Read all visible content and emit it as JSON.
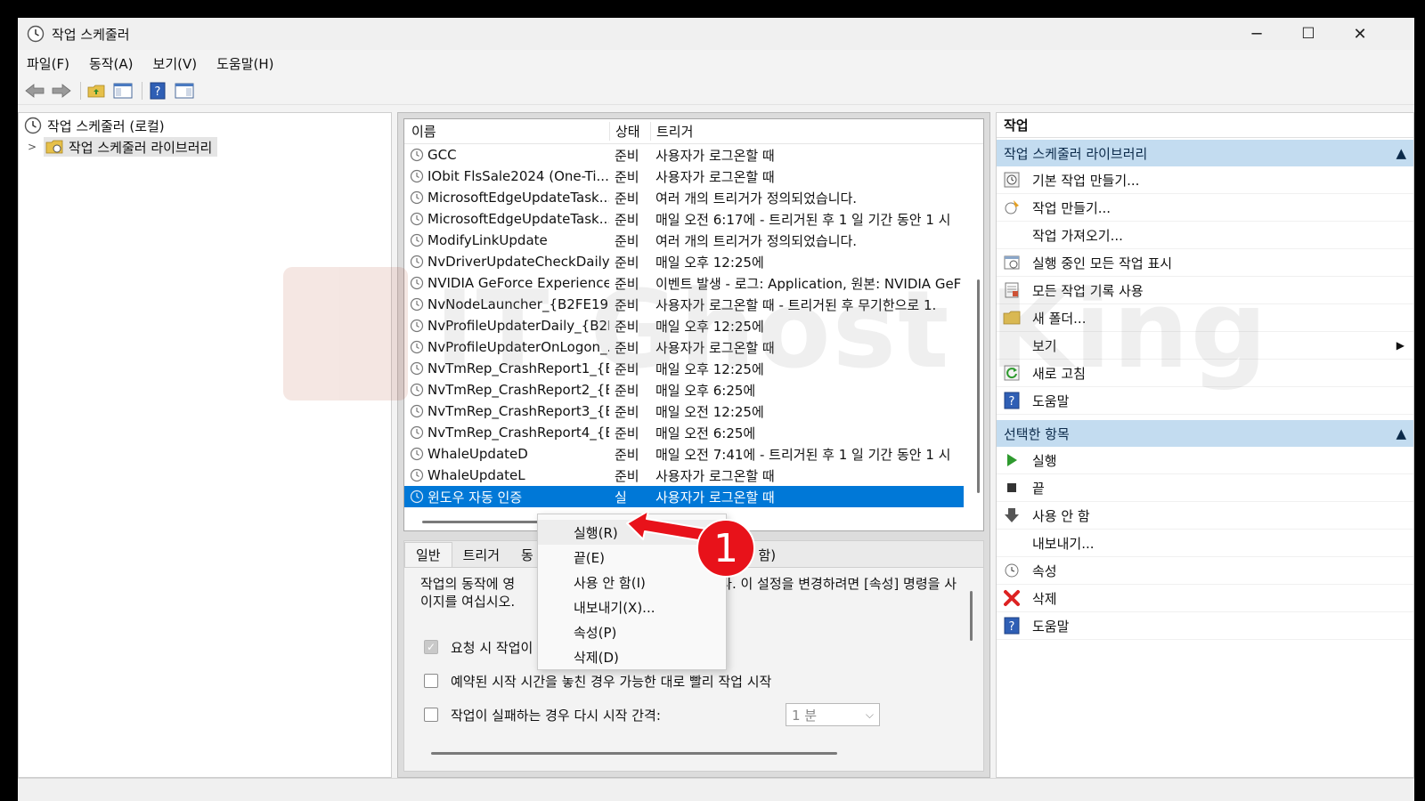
{
  "window": {
    "title": "작업 스케줄러",
    "min": "─",
    "max": "☐",
    "close": "✕"
  },
  "menu": [
    "파일(F)",
    "동작(A)",
    "보기(V)",
    "도움말(H)"
  ],
  "tree": {
    "root": "작업 스케줄러 (로컬)",
    "library": "작업 스케줄러 라이브러리"
  },
  "list": {
    "headers": {
      "name": "이름",
      "state": "상태",
      "trigger": "트리거"
    },
    "rows": [
      {
        "name": "GCC",
        "state": "준비",
        "trigger": "사용자가 로그온할 때"
      },
      {
        "name": "IObit FlsSale2024 (One-Ti...",
        "state": "준비",
        "trigger": "사용자가 로그온할 때"
      },
      {
        "name": "MicrosoftEdgeUpdateTask...",
        "state": "준비",
        "trigger": "여러 개의 트리거가 정의되었습니다."
      },
      {
        "name": "MicrosoftEdgeUpdateTask...",
        "state": "준비",
        "trigger": "매일 오전 6:17에 - 트리거된 후 1 일 기간 동안 1 시"
      },
      {
        "name": "ModifyLinkUpdate",
        "state": "준비",
        "trigger": "여러 개의 트리거가 정의되었습니다."
      },
      {
        "name": "NvDriverUpdateCheckDaily...",
        "state": "준비",
        "trigger": "매일 오후 12:25에"
      },
      {
        "name": "NVIDIA GeForce Experience...",
        "state": "준비",
        "trigger": "이벤트 발생 - 로그: Application, 원본: NVIDIA GeF"
      },
      {
        "name": "NvNodeLauncher_{B2FE19...",
        "state": "준비",
        "trigger": "사용자가 로그온할 때 - 트리거된 후 무기한으로 1."
      },
      {
        "name": "NvProfileUpdaterDaily_{B2F...",
        "state": "준비",
        "trigger": "매일 오후 12:25에"
      },
      {
        "name": "NvProfileUpdaterOnLogon_...",
        "state": "준비",
        "trigger": "사용자가 로그온할 때"
      },
      {
        "name": "NvTmRep_CrashReport1_{B...",
        "state": "준비",
        "trigger": "매일 오후 12:25에"
      },
      {
        "name": "NvTmRep_CrashReport2_{B...",
        "state": "준비",
        "trigger": "매일 오후 6:25에"
      },
      {
        "name": "NvTmRep_CrashReport3_{B...",
        "state": "준비",
        "trigger": "매일 오전 12:25에"
      },
      {
        "name": "NvTmRep_CrashReport4_{B...",
        "state": "준비",
        "trigger": "매일 오전 6:25에"
      },
      {
        "name": "WhaleUpdateD",
        "state": "준비",
        "trigger": "매일 오전 7:41에 - 트리거된 후 1 일 기간 동안 1 시"
      },
      {
        "name": "WhaleUpdateL",
        "state": "준비",
        "trigger": "사용자가 로그온할 때"
      },
      {
        "name": "윈도우 자동 인증",
        "state": "실",
        "trigger": "사용자가 로그온할 때"
      }
    ]
  },
  "detail": {
    "tabs": [
      "일반",
      "트리거",
      "동",
      "안 함)"
    ],
    "text_line1a": "작업의 동작에 영",
    "text_line1b": "다. 이 설정을 변경하려면 [속성] 명령을 사",
    "text_line2": "이지를 여십시오.",
    "chk1": "요청 시 작업이",
    "chk2": "예약된 시작 시간을 놓친 경우 가능한 대로 빨리 작업 시작",
    "chk3": "작업이 실패하는 경우 다시 시작 간격:",
    "combo_value": "1 분"
  },
  "context_menu": [
    "실행(R)",
    "끝(E)",
    "사용 안 함(I)",
    "내보내기(X)...",
    "속성(P)",
    "삭제(D)"
  ],
  "actions": {
    "header": "작업",
    "section1": "작업 스케줄러 라이브러리",
    "section1_items": [
      "기본 작업 만들기...",
      "작업 만들기...",
      "작업 가져오기...",
      "실행 중인 모든 작업 표시",
      "모든 작업 기록 사용",
      "새 폴더...",
      "보기",
      "새로 고침",
      "도움말"
    ],
    "section2": "선택한 항목",
    "section2_items": [
      "실행",
      "끝",
      "사용 안 함",
      "내보내기...",
      "속성",
      "삭제",
      "도움말"
    ]
  },
  "annotation": {
    "badge": "1"
  },
  "watermark": "IT Ghost King",
  "colors": {
    "selection": "#0078d7",
    "section_header": "#c3dcf0",
    "badge": "#e8121a",
    "arrow": "#e8121a"
  }
}
